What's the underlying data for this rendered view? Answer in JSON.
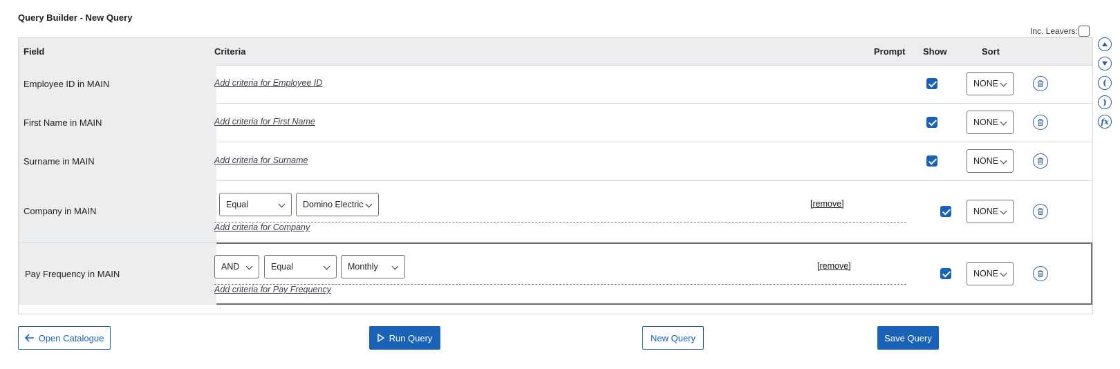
{
  "page": {
    "title": "Query Builder - New Query",
    "inc_leavers_label": "Inc. Leavers:"
  },
  "columns": {
    "field": "Field",
    "criteria": "Criteria",
    "prompt": "Prompt",
    "show": "Show",
    "sort": "Sort"
  },
  "rows": [
    {
      "field": "Employee ID in MAIN",
      "add_link": "Add criteria for Employee ID",
      "show": true,
      "sort": "NONE"
    },
    {
      "field": "First Name in MAIN",
      "add_link": "Add criteria for First Name",
      "show": true,
      "sort": "NONE"
    },
    {
      "field": "Surname in MAIN",
      "add_link": "Add criteria for Surname",
      "show": true,
      "sort": "NONE"
    },
    {
      "field": "Company in MAIN",
      "add_link": "Add criteria for Company",
      "operator": "Equal",
      "value": "Domino Electric",
      "remove": "[remove]",
      "prompt": false,
      "show": true,
      "sort": "NONE"
    },
    {
      "field": "Pay Frequency in MAIN",
      "add_link": "Add criteria for Pay Frequency",
      "conjunction": "AND",
      "operator": "Equal",
      "value": "Monthly",
      "remove": "[remove]",
      "prompt": false,
      "show": true,
      "sort": "NONE"
    }
  ],
  "buttons": {
    "open_catalogue": "Open Catalogue",
    "run_query": "Run Query",
    "new_query": "New Query",
    "save_query": "Save Query"
  },
  "side_icons": [
    "move-up-icon",
    "move-down-icon",
    "open-paren-icon",
    "close-paren-icon",
    "function-icon"
  ],
  "colors": {
    "accent": "#1a62b8",
    "header_bg": "#ecedef"
  }
}
